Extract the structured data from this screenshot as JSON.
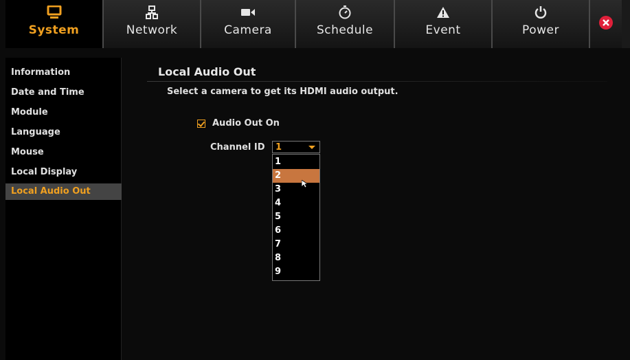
{
  "nav": {
    "tabs": [
      {
        "label": "System",
        "icon": "monitor-icon",
        "active": true
      },
      {
        "label": "Network",
        "icon": "network-icon",
        "active": false
      },
      {
        "label": "Camera",
        "icon": "camera-icon",
        "active": false
      },
      {
        "label": "Schedule",
        "icon": "timer-icon",
        "active": false
      },
      {
        "label": "Event",
        "icon": "warning-icon",
        "active": false
      },
      {
        "label": "Power",
        "icon": "power-icon",
        "active": false
      }
    ],
    "close_icon": "close-icon"
  },
  "sidebar": {
    "items": [
      {
        "label": "Information"
      },
      {
        "label": "Date and Time"
      },
      {
        "label": "Module"
      },
      {
        "label": "Language"
      },
      {
        "label": "Mouse"
      },
      {
        "label": "Local Display"
      },
      {
        "label": "Local Audio Out",
        "active": true
      }
    ]
  },
  "main": {
    "title": "Local Audio Out",
    "description": "Select a camera to get its HDMI audio output.",
    "audio_out_label": "Audio Out On",
    "audio_out_checked": true,
    "channel_label": "Channel ID",
    "channel_value": "1",
    "channel_options": [
      "1",
      "2",
      "3",
      "4",
      "5",
      "6",
      "7",
      "8",
      "9"
    ],
    "highlighted_option": "2"
  },
  "colors": {
    "accent": "#f0a020",
    "highlight": "#c8763f",
    "close": "#e0203a"
  }
}
